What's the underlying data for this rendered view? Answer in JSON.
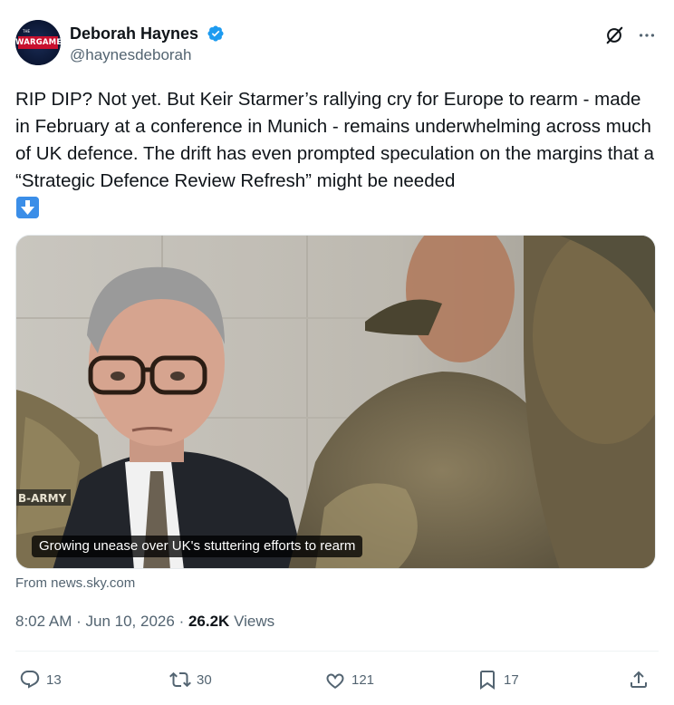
{
  "author": {
    "display_name": "Deborah Haynes",
    "handle": "@haynesdeborah",
    "avatar_label": "WARGAME",
    "avatar_small": "THE"
  },
  "tweet": {
    "text": "RIP DIP? Not yet. But Keir Starmer’s rallying cry for Europe to rearm - made in February at a conference in Munich - remains underwhelming across much of UK defence. The drift has even prompted speculation on the margins that a “Strategic Defence Review Refresh” might be needed",
    "emoji": "down-arrow-emoji"
  },
  "card": {
    "caption": "Growing unease over UK's stuttering efforts to rearm",
    "source": "From news.sky.com",
    "army_patch": "B-ARMY"
  },
  "meta": {
    "time": "8:02 AM",
    "sep1": "·",
    "date": "Jun 10, 2026",
    "sep2": "·",
    "views_count": "26.2K",
    "views_label": "Views"
  },
  "actions": {
    "replies": "13",
    "reposts": "30",
    "likes": "121",
    "bookmarks": "17"
  },
  "colors": {
    "text_primary": "#0f1419",
    "text_secondary": "#536471",
    "verified": "#1d9bf0",
    "divider": "#eff3f4"
  }
}
